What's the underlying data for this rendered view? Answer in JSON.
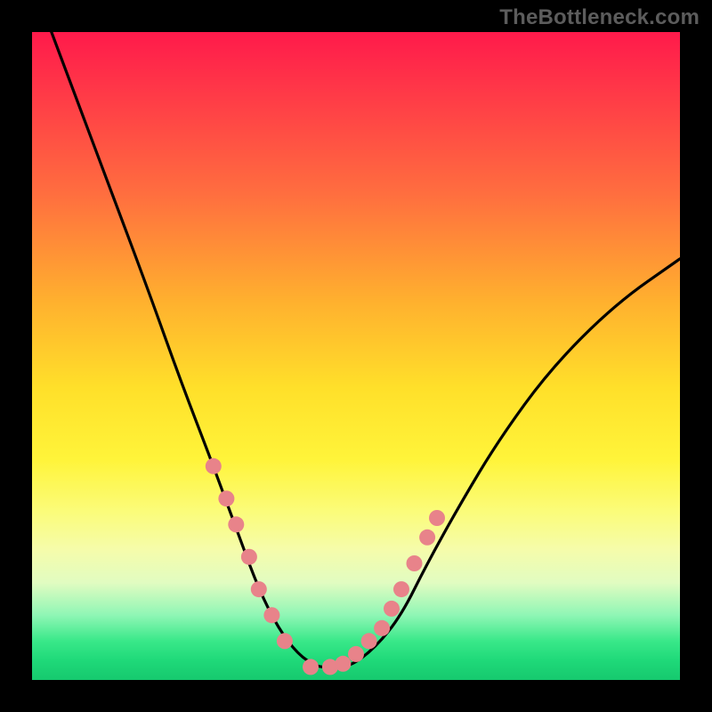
{
  "watermark": "TheBottleneck.com",
  "chart_data": {
    "type": "line",
    "title": "",
    "xlabel": "",
    "ylabel": "",
    "xlim": [
      0,
      100
    ],
    "ylim": [
      0,
      100
    ],
    "series": [
      {
        "name": "bottleneck-curve",
        "x": [
          0,
          6,
          12,
          18,
          23,
          28,
          32,
          35,
          38,
          41,
          44,
          46,
          49,
          53,
          57,
          61,
          66,
          72,
          80,
          90,
          100
        ],
        "values": [
          108,
          92,
          76,
          60,
          46,
          33,
          22,
          14,
          8,
          4,
          2,
          2,
          2,
          5,
          10,
          18,
          27,
          37,
          48,
          58,
          65
        ]
      }
    ],
    "markers": {
      "name": "highlight-dots",
      "x": [
        28,
        30,
        31.5,
        33.5,
        35,
        37,
        39,
        43,
        46,
        48,
        50,
        52,
        54,
        55.5,
        57,
        59,
        61,
        62.5
      ],
      "values": [
        33,
        28,
        24,
        19,
        14,
        10,
        6,
        2,
        2,
        2.5,
        4,
        6,
        8,
        11,
        14,
        18,
        22,
        25
      ]
    },
    "colors": {
      "curve": "#000000",
      "marker": "#e8838a",
      "gradient_top": "#ff1a4b",
      "gradient_mid": "#ffe02a",
      "gradient_bottom": "#16c96e"
    }
  }
}
